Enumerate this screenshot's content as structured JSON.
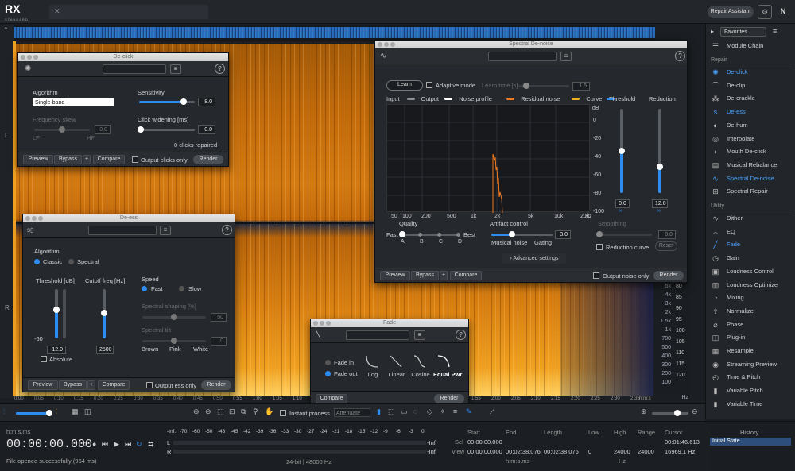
{
  "app": {
    "logo": "RX",
    "edition": "STANDARD",
    "repair_assistant": "Repair Assistant"
  },
  "channels": {
    "left": "L",
    "right": "R"
  },
  "scale": {
    "khz": [
      "5k",
      "4k",
      "3k",
      "2k",
      "1.5k",
      "1k",
      "700",
      "500",
      "400",
      "300",
      "200",
      "100"
    ],
    "db": [
      "80",
      "85",
      "90",
      "95",
      "100",
      "105",
      "110",
      "115",
      "120"
    ],
    "khz_unit": "Hz",
    "db_unit": "dB"
  },
  "timeline": {
    "ticks": [
      "0:00",
      "0:05",
      "0:10",
      "0:15",
      "0:20",
      "0:25",
      "0:30",
      "0:35",
      "0:40",
      "0:45",
      "0:50",
      "0:55",
      "1:00",
      "1:05",
      "1:10",
      "1:15",
      "1:20",
      "1:25",
      "1:30",
      "1:35",
      "1:40",
      "1:45",
      "1:50",
      "1:55",
      "2:00",
      "2:05",
      "2:10",
      "2:15",
      "2:20",
      "2:25",
      "2:30",
      "2:35"
    ],
    "unit": "h:m:s"
  },
  "sidebar": {
    "favorites": "Favorites",
    "module_chain": "Module Chain",
    "repair_head": "Repair",
    "repair": [
      {
        "label": "De-click",
        "icon": "✺",
        "blue": true
      },
      {
        "label": "De-clip",
        "icon": "⌒",
        "blue": false
      },
      {
        "label": "De-crackle",
        "icon": "⁂",
        "blue": false
      },
      {
        "label": "De-ess",
        "icon": "s",
        "blue": true
      },
      {
        "label": "De-hum",
        "icon": "◐",
        "blue": false
      },
      {
        "label": "Interpolate",
        "icon": "◎",
        "blue": false
      },
      {
        "label": "Mouth De-click",
        "icon": "◗",
        "blue": false
      },
      {
        "label": "Musical Rebalance",
        "icon": "▤",
        "blue": false
      },
      {
        "label": "Spectral De-noise",
        "icon": "∿",
        "blue": true
      },
      {
        "label": "Spectral Repair",
        "icon": "⊞",
        "blue": false
      }
    ],
    "utility_head": "Utility",
    "utility": [
      {
        "label": "Dither",
        "icon": "∿",
        "blue": false
      },
      {
        "label": "EQ",
        "icon": "⌢",
        "blue": false
      },
      {
        "label": "Fade",
        "icon": "╱",
        "blue": true
      },
      {
        "label": "Gain",
        "icon": "◷",
        "blue": false
      },
      {
        "label": "Loudness Control",
        "icon": "▣",
        "blue": false
      },
      {
        "label": "Loudness Optimize",
        "icon": "▥",
        "blue": false
      },
      {
        "label": "Mixing",
        "icon": "◔",
        "blue": false
      },
      {
        "label": "Normalize",
        "icon": "⇧",
        "blue": false
      },
      {
        "label": "Phase",
        "icon": "⌀",
        "blue": false
      },
      {
        "label": "Plug-in",
        "icon": "◫",
        "blue": false
      },
      {
        "label": "Resample",
        "icon": "▦",
        "blue": false
      },
      {
        "label": "Streaming Preview",
        "icon": "◉",
        "blue": false
      },
      {
        "label": "Time & Pitch",
        "icon": "◴",
        "blue": false
      },
      {
        "label": "Variable Pitch",
        "icon": "▮",
        "blue": false
      },
      {
        "label": "Variable Time",
        "icon": "▮",
        "blue": false
      }
    ],
    "history_title": "History",
    "history_item": "Initial State"
  },
  "declick": {
    "title": "De-click",
    "algorithm_label": "Algorithm",
    "algorithm_value": "Single-band",
    "sensitivity_label": "Sensitivity",
    "sensitivity_value": "8.0",
    "sensitivity": 0.8,
    "freqskew_label": "Frequency skew",
    "freqskew_value": "0.0",
    "lf": "LF",
    "hf": "HF",
    "widening_label": "Click widening [ms]",
    "widening_value": "0.0",
    "status": "0 clicks repaired",
    "preview": "Preview",
    "bypass": "Bypass",
    "plus": "+",
    "compare": "Compare",
    "output_only": "Output clicks only",
    "render": "Render"
  },
  "deess": {
    "title": "De-ess",
    "algorithm_label": "Algorithm",
    "classic": "Classic",
    "spectral": "Spectral",
    "threshold_label": "Threshold [dB]",
    "threshold_value": "-12.0",
    "threshold_min": "-60",
    "cutoff_label": "Cutoff freq [Hz]",
    "cutoff_value": "2500",
    "absolute": "Absolute",
    "speed_label": "Speed",
    "fast": "Fast",
    "slow": "Slow",
    "shaping_label": "Spectral shaping [%]",
    "shaping_value": "50",
    "tilt_label": "Spectral tilt",
    "tilt_value": "0",
    "brown": "Brown",
    "pink": "Pink",
    "white": "White",
    "preview": "Preview",
    "bypass": "Bypass",
    "plus": "+",
    "compare": "Compare",
    "output_only": "Output ess only",
    "render": "Render"
  },
  "denoise": {
    "title": "Spectral De-noise",
    "learn": "Learn",
    "adaptive": "Adaptive mode",
    "learn_time_label": "Learn time [s]",
    "learn_time_value": "1.5",
    "legend": [
      {
        "label": "Input",
        "color": "#8a8f96"
      },
      {
        "label": "Output",
        "color": "#ffffff"
      },
      {
        "label": "Noise profile",
        "color": "#f07a20"
      },
      {
        "label": "Residual noise",
        "color": "#f0b020"
      },
      {
        "label": "Curve",
        "color": "#2d8cf0"
      }
    ],
    "threshold_label": "Threshold",
    "threshold_value": "0.0",
    "reduction_label": "Reduction",
    "reduction_value": "12.0",
    "db_label": "dB",
    "db_ticks": [
      "0",
      "-20",
      "-40",
      "-60",
      "-80",
      "-100"
    ],
    "hz_ticks": [
      "50",
      "100",
      "200",
      "500",
      "1k",
      "2k",
      "5k",
      "10k",
      "20k"
    ],
    "hz_unit": "Hz",
    "quality_label": "Quality",
    "fast": "Fast",
    "best": "Best",
    "q_opts": [
      "A",
      "B",
      "C",
      "D"
    ],
    "artifact_label": "Artifact control",
    "musical_noise": "Musical noise",
    "gating": "Gating",
    "artifact_value": "3.0",
    "smoothing_label": "Smoothing",
    "smoothing_value": "0.0",
    "reduction_curve": "Reduction curve",
    "reset": "Reset",
    "advanced": "Advanced settings",
    "preview": "Preview",
    "bypass": "Bypass",
    "plus": "+",
    "compare": "Compare",
    "output_only": "Output noise only",
    "render": "Render"
  },
  "fade": {
    "title": "Fade",
    "fade_in": "Fade in",
    "fade_out": "Fade out",
    "curves": [
      "Log",
      "Linear",
      "Cosine",
      "Equal Pwr"
    ],
    "compare": "Compare",
    "render": "Render"
  },
  "toolbar": {
    "instant_process": "Instant process",
    "attenuate": "Attenuate"
  },
  "transport": {
    "time_format": "h:m:s.ms",
    "time": "00:00:00.000",
    "status": "File opened successfully (964 ms)",
    "meter_ticks": [
      "-Inf.",
      "-70",
      "-60",
      "-50",
      "-48",
      "-45",
      "-42",
      "-39",
      "-36",
      "-33",
      "-30",
      "-27",
      "-24",
      "-21",
      "-18",
      "-15",
      "-12",
      "-9",
      "-6",
      "-3",
      "0"
    ],
    "meter_l": "L",
    "meter_r": "R",
    "peak": "-Inf",
    "format": "24-bit | 48000 Hz"
  },
  "selection": {
    "start_label": "Start",
    "end_label": "End",
    "length_label": "Length",
    "low_label": "Low",
    "high_label": "High",
    "range_label": "Range",
    "cursor_label": "Cursor",
    "sel_label": "Sel",
    "view_label": "View",
    "sel_start": "00:00:00.000",
    "sel_end": "",
    "sel_length": "",
    "view_start": "00:00:00.000",
    "view_end": "00:02:38.076",
    "view_length": "00:02:38.076",
    "sel_end2": "00:02:38.076",
    "view_low": "0",
    "view_high": "24000",
    "view_range": "24000",
    "cursor_time": "00:01:46.613",
    "cursor_freq": "16969.1 Hz",
    "unit_time": "h:m:s.ms",
    "unit_hz": "Hz"
  }
}
